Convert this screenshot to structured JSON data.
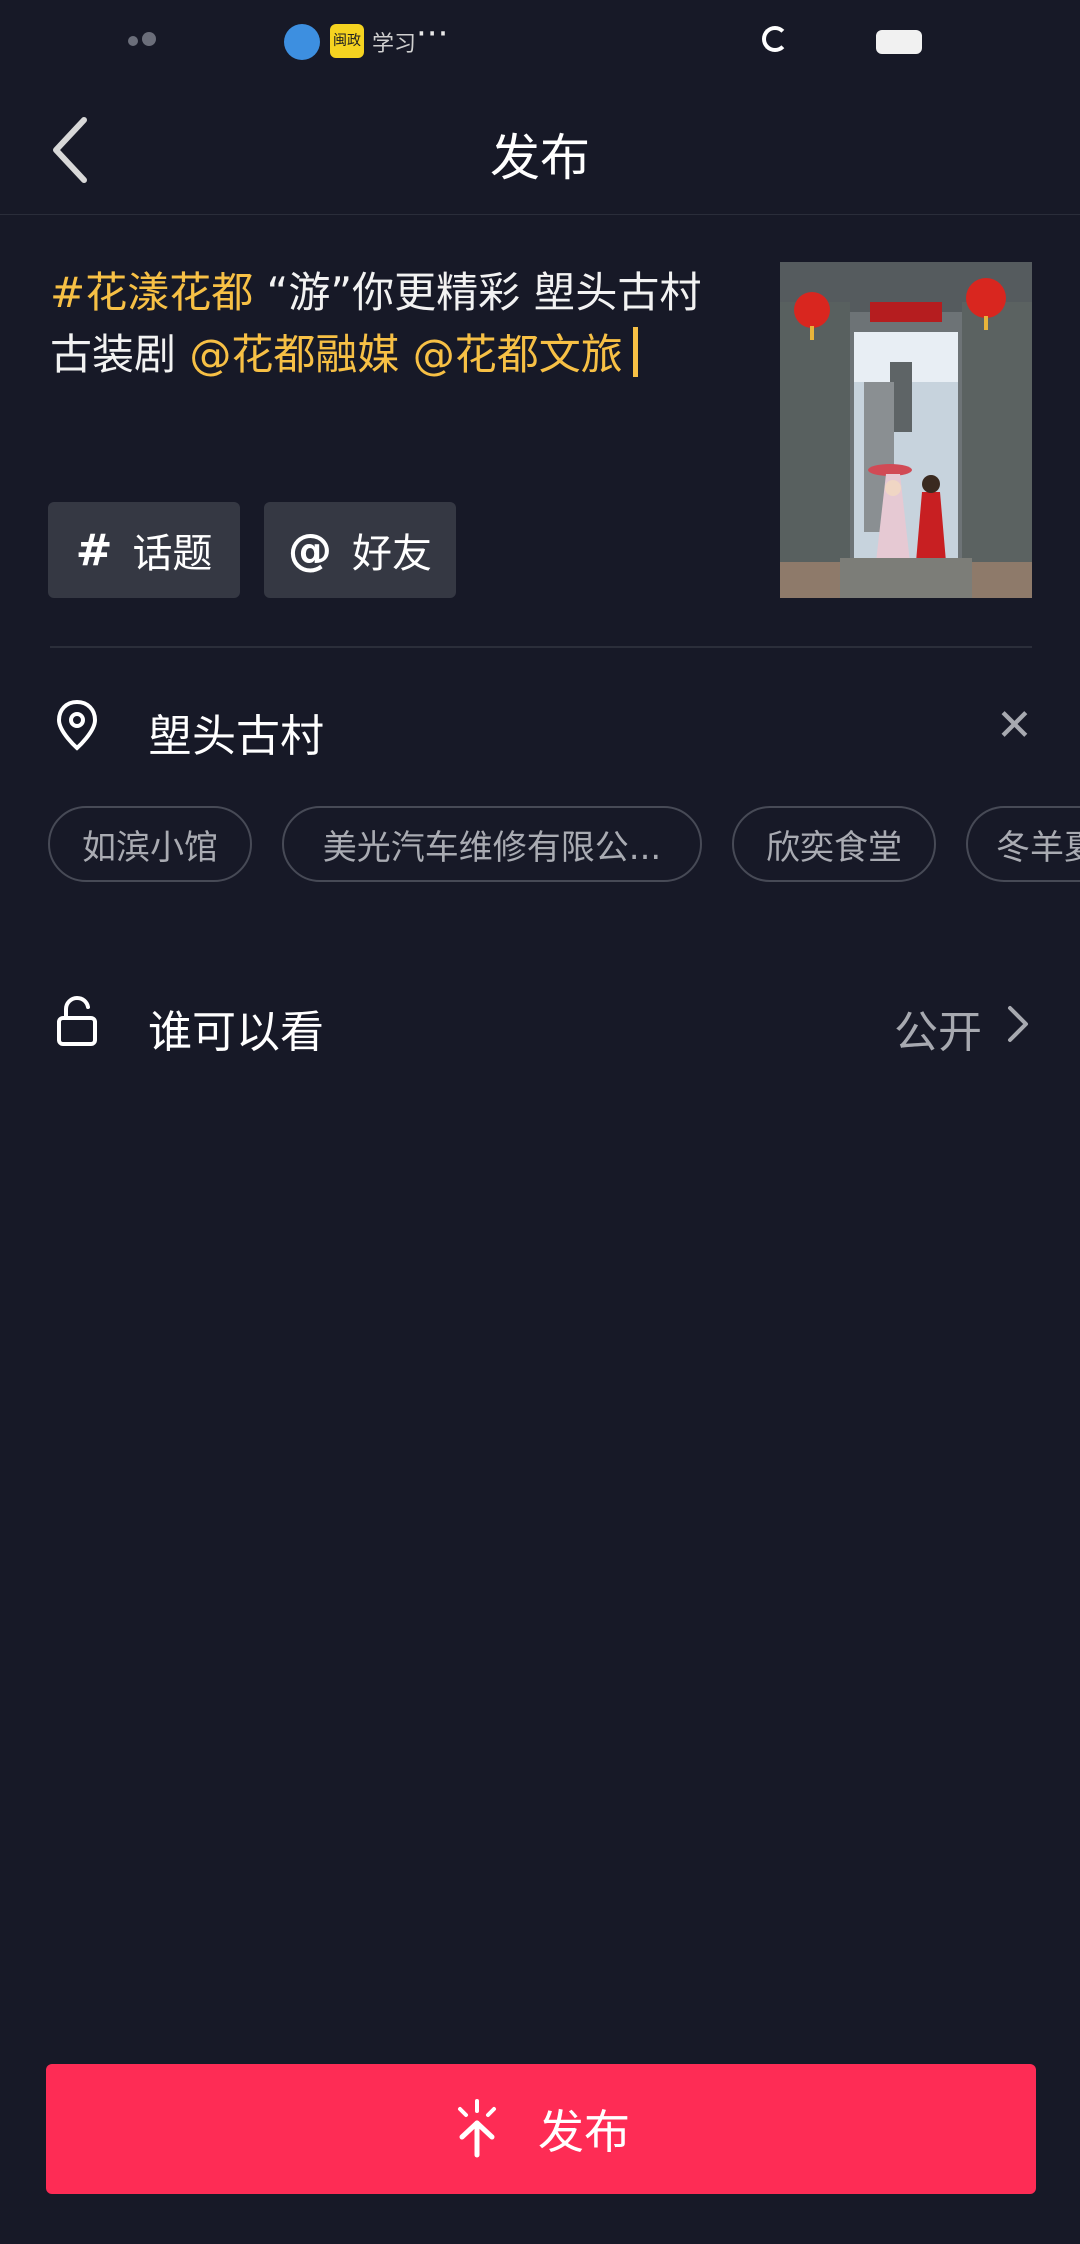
{
  "status_bar": {
    "app_icon_text": "闽政",
    "study_text": "学习",
    "more": "···"
  },
  "header": {
    "title": "发布"
  },
  "caption": {
    "hashtag": "#花漾花都",
    "text_line1": " “游”你更精彩  塱头古村",
    "text_line2": "古装剧  ",
    "mentions": "@花都融媒 @花都文旅"
  },
  "buttons": {
    "topic_icon": "#",
    "topic": "话题",
    "friend_icon": "@",
    "friend": "好友"
  },
  "location": {
    "name": "塱头古村",
    "icons": {
      "pin": "location-pin-icon",
      "close": "close-icon"
    },
    "suggestions": [
      "如滨小馆",
      "美光汽车维修有限公...",
      "欣奕食堂",
      "冬羊夏"
    ]
  },
  "visibility": {
    "label": "谁可以看",
    "value": "公开",
    "icon": "unlock-icon"
  },
  "publish_button": {
    "label": "发布",
    "icon": "upload-sparkle-icon"
  },
  "colors": {
    "background": "#171927",
    "accent": "#f7c045",
    "publish": "#fe2c55"
  }
}
